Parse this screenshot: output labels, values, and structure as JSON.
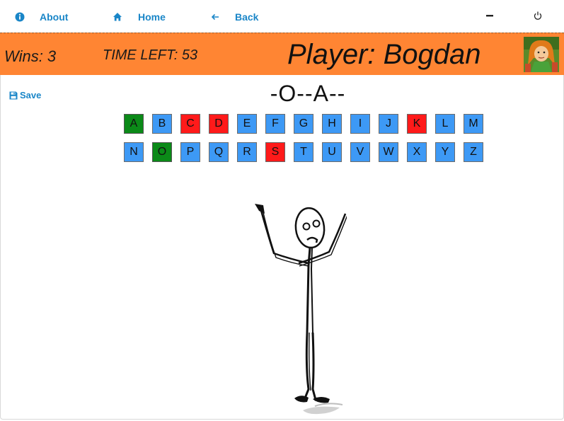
{
  "nav": {
    "about_label": "About",
    "home_label": "Home",
    "back_label": "Back"
  },
  "status": {
    "wins": "Wins: 3",
    "time_left": "TIME LEFT: 53",
    "player": "Player: Bogdan"
  },
  "save_label": "Save",
  "word": "-O--A--",
  "letters_row1": [
    {
      "letter": "A",
      "state": "correct"
    },
    {
      "letter": "B",
      "state": "unused"
    },
    {
      "letter": "C",
      "state": "wrong"
    },
    {
      "letter": "D",
      "state": "wrong"
    },
    {
      "letter": "E",
      "state": "unused"
    },
    {
      "letter": "F",
      "state": "unused"
    },
    {
      "letter": "G",
      "state": "unused"
    },
    {
      "letter": "H",
      "state": "unused"
    },
    {
      "letter": "I",
      "state": "unused"
    },
    {
      "letter": "J",
      "state": "unused"
    },
    {
      "letter": "K",
      "state": "wrong"
    },
    {
      "letter": "L",
      "state": "unused"
    },
    {
      "letter": "M",
      "state": "unused"
    }
  ],
  "letters_row2": [
    {
      "letter": "N",
      "state": "unused"
    },
    {
      "letter": "O",
      "state": "correct"
    },
    {
      "letter": "P",
      "state": "unused"
    },
    {
      "letter": "Q",
      "state": "unused"
    },
    {
      "letter": "R",
      "state": "unused"
    },
    {
      "letter": "S",
      "state": "wrong"
    },
    {
      "letter": "T",
      "state": "unused"
    },
    {
      "letter": "U",
      "state": "unused"
    },
    {
      "letter": "V",
      "state": "unused"
    },
    {
      "letter": "W",
      "state": "unused"
    },
    {
      "letter": "X",
      "state": "unused"
    },
    {
      "letter": "Y",
      "state": "unused"
    },
    {
      "letter": "Z",
      "state": "unused"
    }
  ],
  "colors": {
    "accent": "#1a86c8",
    "status_bar": "#ff8533",
    "key_unused": "#3d99f5",
    "key_correct": "#0b8a18",
    "key_wrong": "#ff1a1a"
  },
  "icons": {
    "about": "info-icon",
    "home": "home-icon",
    "back": "arrow-left-icon",
    "minimize": "minimize-icon",
    "power": "power-icon",
    "save": "floppy-disk-icon"
  }
}
